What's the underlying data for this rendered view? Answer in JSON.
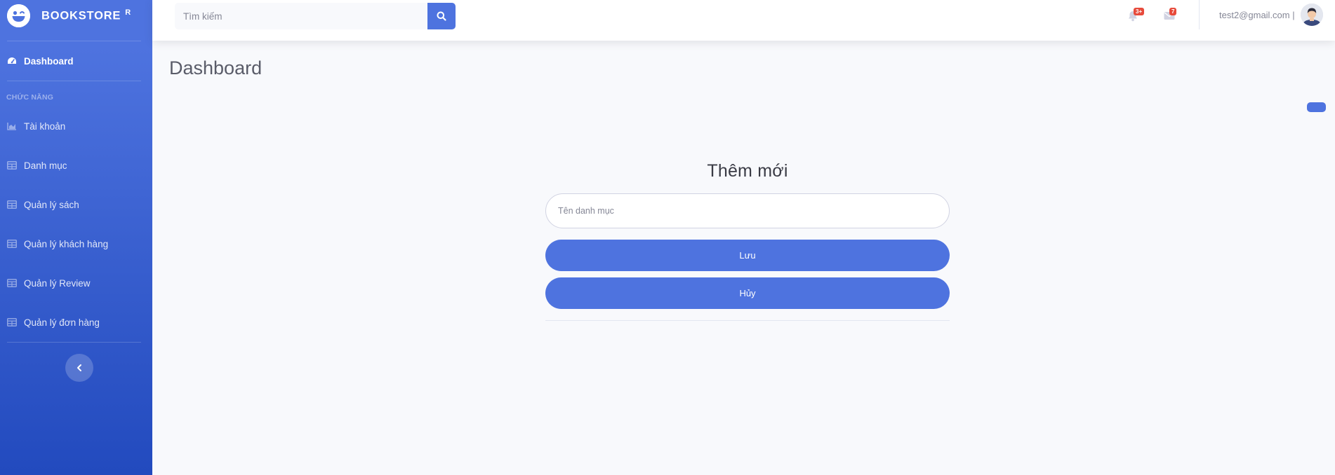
{
  "sidebar": {
    "brand": "BOOKSTORE",
    "brand_sup": "R",
    "dashboard": "Dashboard",
    "heading": "CHỨC NĂNG",
    "items": [
      {
        "label": "Tài khoản",
        "icon": "chart-area-icon"
      },
      {
        "label": "Danh mục",
        "icon": "table-icon"
      },
      {
        "label": "Quản lý sách",
        "icon": "table-icon"
      },
      {
        "label": "Quản lý khách hàng",
        "icon": "table-icon"
      },
      {
        "label": "Quản lý Review",
        "icon": "table-icon"
      },
      {
        "label": "Quản lý đơn hàng",
        "icon": "table-icon"
      }
    ]
  },
  "topbar": {
    "search_placeholder": "Tìm kiếm",
    "alerts_badge": "3+",
    "messages_badge": "7",
    "user_email": "test2@gmail.com |"
  },
  "main": {
    "page_title": "Dashboard",
    "form": {
      "title": "Thêm mới",
      "name_placeholder": "Tên danh mục",
      "save_label": "Lưu",
      "cancel_label": "Hủy"
    }
  },
  "colors": {
    "primary": "#4e73df",
    "sidebar_bottom": "#224abe",
    "badge": "#e74a3b",
    "background": "#f8f9fc"
  }
}
